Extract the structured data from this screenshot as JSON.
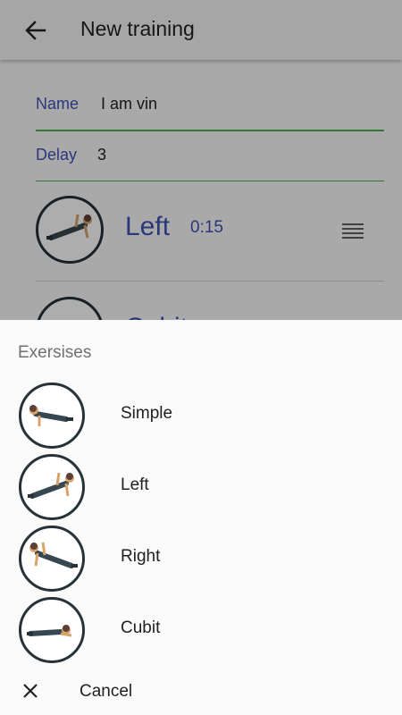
{
  "toolbar": {
    "title": "New training",
    "back_icon": "arrow-back-icon"
  },
  "form": {
    "name_label": "Name",
    "name_value": "I am vin",
    "delay_label": "Delay",
    "delay_value": "3"
  },
  "training_exercises": [
    {
      "name": "Left",
      "duration": "0:15",
      "icon": "side-plank-left-icon"
    },
    {
      "name": "Cubit",
      "duration": "",
      "icon": "forearm-plank-icon"
    }
  ],
  "sheet": {
    "title": "Exersises",
    "items": [
      {
        "label": "Simple",
        "icon": "plank-simple-icon"
      },
      {
        "label": "Left",
        "icon": "side-plank-left-icon"
      },
      {
        "label": "Right",
        "icon": "side-plank-right-icon"
      },
      {
        "label": "Cubit",
        "icon": "forearm-plank-icon"
      }
    ],
    "cancel_label": "Cancel"
  },
  "colors": {
    "accent": "#3f51b5",
    "underline": "#4caf50",
    "avatar_border": "#263238"
  }
}
